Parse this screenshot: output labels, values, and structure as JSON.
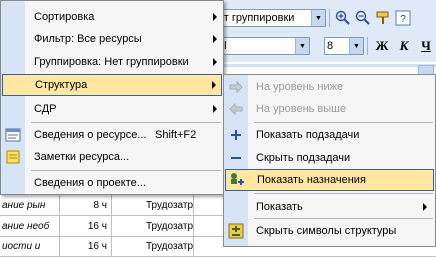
{
  "toolbar": {
    "group_combo_value": "ет группировки",
    "font_combo_value": "al",
    "size_combo_value": "8",
    "bold_label": "Ж",
    "italic_label": "К",
    "underline_label": "Ч",
    "icons": [
      "zoom-in-icon",
      "zoom-out-icon",
      "format-painter-icon",
      "help-icon"
    ]
  },
  "grid": {
    "rows": [
      {
        "name": "ание рын",
        "work": "8 ч",
        "details": "Трудозатр."
      },
      {
        "name": "ание необ",
        "work": "16 ч",
        "details": "Трудозатр."
      },
      {
        "name": "иости и",
        "work": "16 ч",
        "details": "Трудозатр."
      }
    ]
  },
  "menu": {
    "items": [
      {
        "label": "Сортировка",
        "has_submenu": true
      },
      {
        "label": "Фильтр: Все ресурсы",
        "has_submenu": true
      },
      {
        "label": "Группировка: Нет группировки",
        "has_submenu": true
      },
      {
        "label": "Структура",
        "has_submenu": true,
        "highlighted": true
      },
      {
        "label": "СДР",
        "has_submenu": true
      },
      {
        "label": "Сведения о ресурсе...",
        "shortcut": "Shift+F2",
        "icon": "resource-info-icon"
      },
      {
        "label": "Заметки ресурса...",
        "icon": "resource-notes-icon"
      },
      {
        "label": "Сведения о проекте..."
      }
    ]
  },
  "submenu": {
    "items": [
      {
        "label": "На уровень ниже",
        "disabled": true,
        "icon": "indent-arrow-icon"
      },
      {
        "label": "На уровень выше",
        "disabled": true,
        "icon": "outdent-arrow-icon"
      },
      {
        "label": "Показать подзадачи",
        "icon": "plus-icon"
      },
      {
        "label": "Скрыть подзадачи",
        "icon": "minus-icon"
      },
      {
        "label": "Показать назначения",
        "highlighted": true,
        "icon": "show-assignments-icon"
      },
      {
        "label": "Показать",
        "has_submenu": true
      },
      {
        "label": "Скрыть символы структуры",
        "icon": "outline-symbols-icon"
      }
    ]
  }
}
